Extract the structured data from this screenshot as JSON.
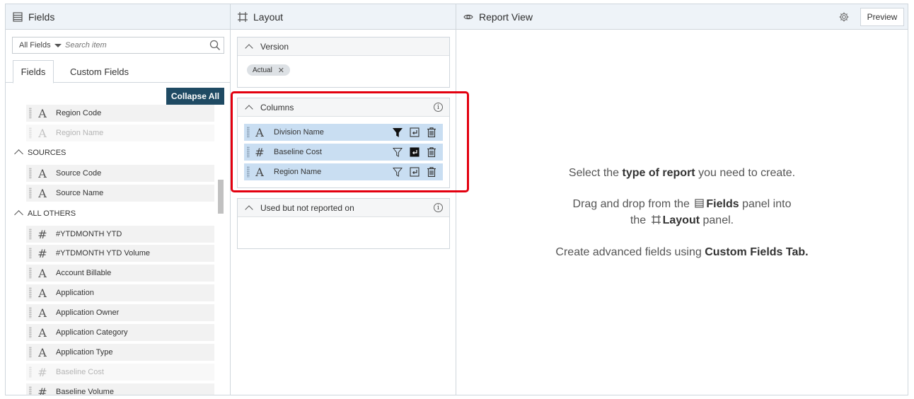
{
  "fields_panel": {
    "title": "Fields",
    "filter_label": "All Fields",
    "search_placeholder": "Search item",
    "tabs": [
      "Fields",
      "Custom Fields"
    ],
    "collapse_all_label": "Collapse All",
    "top_items": [
      {
        "type": "text",
        "label": "Region Code",
        "faded": false
      },
      {
        "type": "text",
        "label": "Region Name",
        "faded": true
      }
    ],
    "groups": [
      {
        "name": "SOURCES",
        "items": [
          {
            "type": "text",
            "label": "Source Code",
            "faded": false
          },
          {
            "type": "text",
            "label": "Source Name",
            "faded": false
          }
        ]
      },
      {
        "name": "ALL OTHERS",
        "items": [
          {
            "type": "number",
            "label": "#YTDMONTH YTD",
            "faded": false
          },
          {
            "type": "number",
            "label": "#YTDMONTH YTD Volume",
            "faded": false
          },
          {
            "type": "text",
            "label": "Account Billable",
            "faded": false
          },
          {
            "type": "text",
            "label": "Application",
            "faded": false
          },
          {
            "type": "text",
            "label": "Application Owner",
            "faded": false
          },
          {
            "type": "text",
            "label": "Application Category",
            "faded": false
          },
          {
            "type": "text",
            "label": "Application Type",
            "faded": false
          },
          {
            "type": "number",
            "label": "Baseline Cost",
            "faded": true
          },
          {
            "type": "number",
            "label": "Baseline Volume",
            "faded": false
          }
        ]
      }
    ]
  },
  "layout_panel": {
    "title": "Layout",
    "version_card": {
      "title": "Version",
      "chip": "Actual"
    },
    "columns_card": {
      "title": "Columns",
      "rows": [
        {
          "type": "text",
          "label": "Division Name",
          "filter_active": true,
          "newline_active": false
        },
        {
          "type": "number",
          "label": "Baseline Cost",
          "filter_active": false,
          "newline_active": true
        },
        {
          "type": "text",
          "label": "Region Name",
          "filter_active": false,
          "newline_active": false
        }
      ]
    },
    "unused_card": {
      "title": "Used but not reported on"
    }
  },
  "report_panel": {
    "title": "Report View",
    "preview_label": "Preview",
    "line1_pre": "Select the ",
    "line1_bold": "type of report",
    "line1_post": " you need to create.",
    "line2_pre": "Drag and drop from the",
    "line2_bold": "Fields",
    "line2_post": " panel into",
    "line3_pre": "the",
    "line3_bold": "Layout",
    "line3_post": " panel.",
    "line4_pre": "Create advanced fields using ",
    "line4_bold": "Custom Fields Tab."
  },
  "colors": {
    "accent": "#1f4a63",
    "highlight": "#e3000f",
    "column_row": "#c9def2",
    "header_bg": "#eef3f8"
  }
}
